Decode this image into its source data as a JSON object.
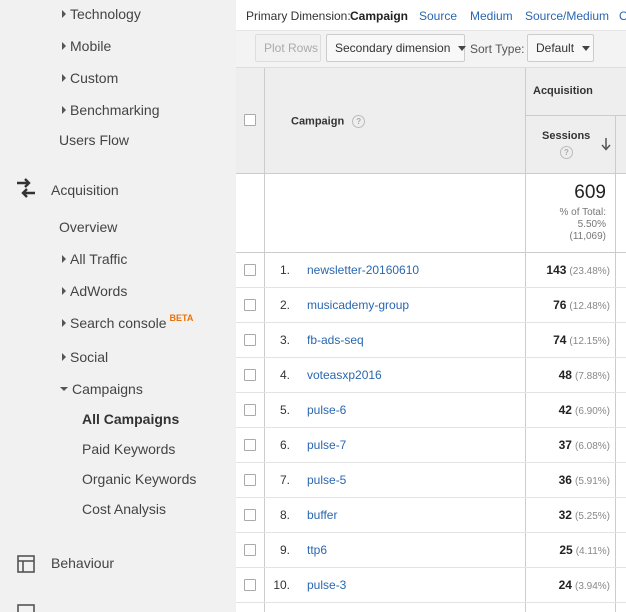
{
  "sidebar": {
    "items": [
      {
        "label": "Technology"
      },
      {
        "label": "Mobile"
      },
      {
        "label": "Custom"
      },
      {
        "label": "Benchmarking"
      },
      {
        "label": "Users Flow"
      },
      {
        "label": "Acquisition"
      },
      {
        "label": "Overview"
      },
      {
        "label": "All Traffic"
      },
      {
        "label": "AdWords"
      },
      {
        "label": "Search console",
        "badge": "BETA"
      },
      {
        "label": "Social"
      },
      {
        "label": "Campaigns"
      },
      {
        "label": "All Campaigns"
      },
      {
        "label": "Paid Keywords"
      },
      {
        "label": "Organic Keywords"
      },
      {
        "label": "Cost Analysis"
      },
      {
        "label": "Behaviour"
      }
    ]
  },
  "topbar": {
    "primary_label": "Primary Dimension:",
    "active": "Campaign",
    "links": [
      "Source",
      "Medium",
      "Source/Medium",
      "O"
    ]
  },
  "toolbar": {
    "plot_rows": "Plot Rows",
    "secondary": "Secondary dimension",
    "sort_type_label": "Sort Type:",
    "sort_type_value": "Default"
  },
  "table": {
    "campaign_header": "Campaign",
    "acquisition_header": "Acquisition",
    "sessions_header": "Sessions",
    "total": {
      "value": "609",
      "line1": "% of Total:",
      "line2": "5.50%",
      "line3": "(11,069)"
    },
    "rows": [
      {
        "rank": "1.",
        "name": "newsletter-20160610",
        "sessions": "143",
        "pct": "(23.48%)"
      },
      {
        "rank": "2.",
        "name": "musicademy-group",
        "sessions": "76",
        "pct": "(12.48%)"
      },
      {
        "rank": "3.",
        "name": "fb-ads-seq",
        "sessions": "74",
        "pct": "(12.15%)"
      },
      {
        "rank": "4.",
        "name": "voteasxp2016",
        "sessions": "48",
        "pct": "(7.88%)"
      },
      {
        "rank": "5.",
        "name": "pulse-6",
        "sessions": "42",
        "pct": "(6.90%)"
      },
      {
        "rank": "6.",
        "name": "pulse-7",
        "sessions": "37",
        "pct": "(6.08%)"
      },
      {
        "rank": "7.",
        "name": "pulse-5",
        "sessions": "36",
        "pct": "(5.91%)"
      },
      {
        "rank": "8.",
        "name": "buffer",
        "sessions": "32",
        "pct": "(5.25%)"
      },
      {
        "rank": "9.",
        "name": "ttp6",
        "sessions": "25",
        "pct": "(4.11%)"
      },
      {
        "rank": "10.",
        "name": "pulse-3",
        "sessions": "24",
        "pct": "(3.94%)"
      }
    ]
  }
}
